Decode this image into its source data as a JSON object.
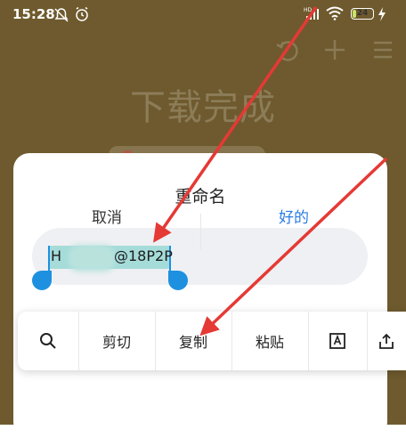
{
  "statusbar": {
    "time": "15:28",
    "battery": "24",
    "battery_level": 0.24
  },
  "background": {
    "title": "下载完成"
  },
  "dialog": {
    "title": "重命名",
    "filename_start": "H",
    "filename_end": "@18P2P",
    "cancel_label": "取消",
    "ok_label": "好的"
  },
  "context_menu": {
    "items": [
      {
        "label": "",
        "icon": "search-icon"
      },
      {
        "label": "剪切"
      },
      {
        "label": "复制"
      },
      {
        "label": "粘贴"
      },
      {
        "label": "",
        "icon": "text-select-icon"
      },
      {
        "label": "",
        "icon": "share-icon"
      }
    ]
  },
  "colors": {
    "accent": "#1e90e0",
    "ok": "#2a7de1",
    "arrow": "#e53935",
    "background": "#6e5a2e"
  }
}
